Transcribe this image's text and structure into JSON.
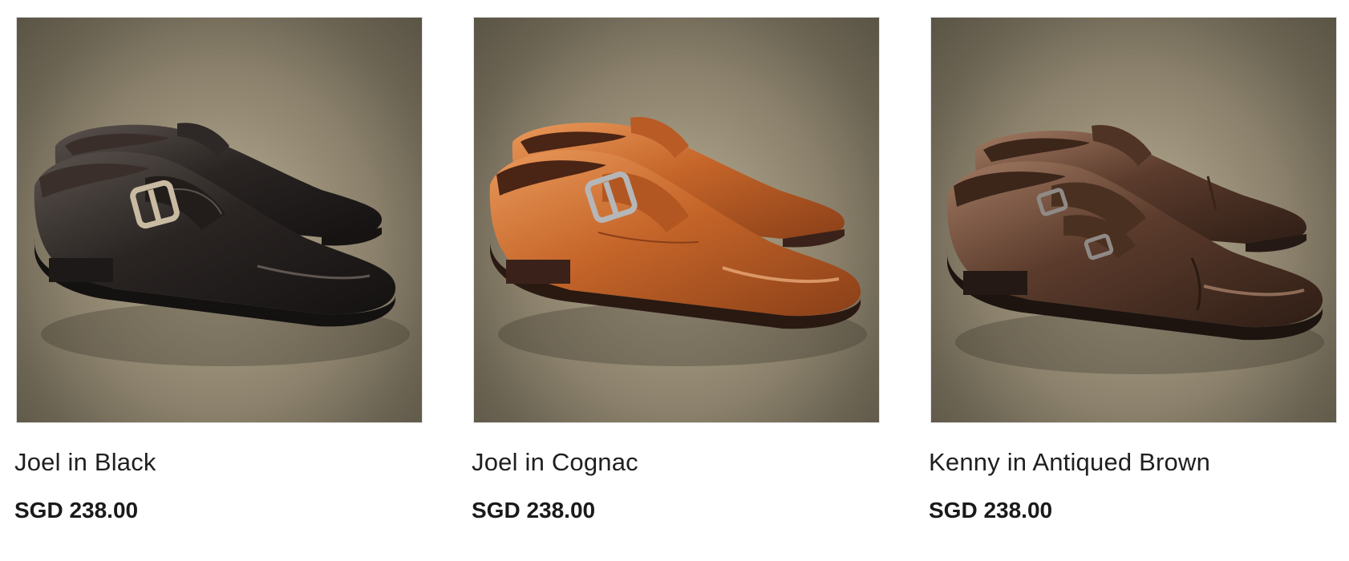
{
  "products": [
    {
      "name": "Joel in Black",
      "price": "SGD 238.00",
      "image_alt": "Joel in Black monk strap shoes",
      "colors": {
        "upper": "#2a2523",
        "highlight": "#6b625c",
        "sole": "#1a1716",
        "buckle": "#c9bba2"
      }
    },
    {
      "name": "Joel in Cognac",
      "price": "SGD 238.00",
      "image_alt": "Joel in Cognac monk strap shoes",
      "colors": {
        "upper": "#c2642a",
        "highlight": "#e99a5e",
        "sole": "#3a221a",
        "buckle": "#b5b6b8"
      }
    },
    {
      "name": "Kenny in Antiqued Brown",
      "price": "SGD 238.00",
      "image_alt": "Kenny in Antiqued Brown double monk strap shoes",
      "colors": {
        "upper": "#5b3b2c",
        "highlight": "#a17a62",
        "sole": "#241914",
        "buckle": "#8f8a86"
      }
    }
  ]
}
